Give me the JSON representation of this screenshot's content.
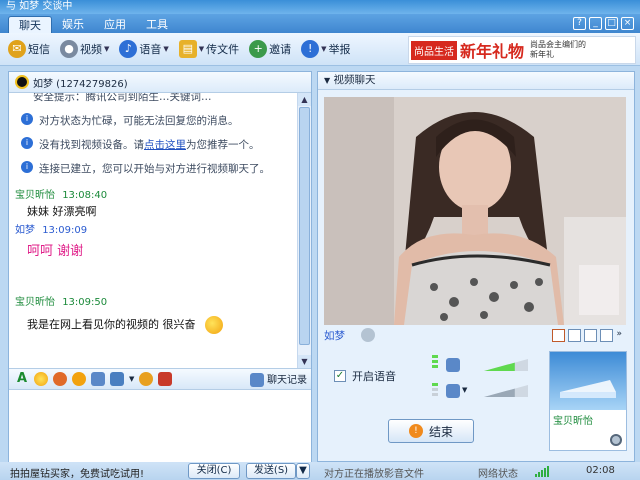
{
  "window": {
    "title": "与 如梦 交谈中"
  },
  "menu": {
    "tabs": [
      "聊天",
      "娱乐",
      "应用",
      "工具"
    ],
    "window_buttons": [
      "?",
      "_",
      "□",
      "×"
    ]
  },
  "toolbar": {
    "items": [
      {
        "label": "短信",
        "icon": "sms-icon",
        "color": "#e0a21b"
      },
      {
        "label": "视频",
        "icon": "camera-icon",
        "color": "#7a8aa0"
      },
      {
        "label": "语音",
        "icon": "microphone-icon",
        "color": "#2d6fd6"
      },
      {
        "label": "传文件",
        "icon": "folder-icon",
        "color": "#e7b12a"
      },
      {
        "label": "邀请",
        "icon": "invite-icon",
        "color": "#3b9a4b"
      },
      {
        "label": "举报",
        "icon": "report-icon",
        "color": "#2d6fd6"
      }
    ]
  },
  "ad": {
    "tag": "尚品生活",
    "headline": "新年礼物",
    "small": "尚品会主编们的新年礼"
  },
  "contact": {
    "name_and_qq": "如梦 (1274279826)"
  },
  "chat": {
    "truncated_line": "安全提示：腾讯公司到陌生…关键词…",
    "system_messages": [
      {
        "text": "对方状态为忙碌，可能无法回复您的消息。"
      },
      {
        "text_before": "没有找到视频设备。请",
        "link": "点击这里",
        "text_after": "为您推荐一个。"
      },
      {
        "text": "连接已建立，您可以开始与对方进行视频聊天了。"
      }
    ],
    "messages": [
      {
        "sender": "宝贝昕怡",
        "time": "13:08:40",
        "text": "妹妹  好漂亮啊",
        "sender_color": "green"
      },
      {
        "sender": "如梦",
        "time": "13:09:09",
        "text": "呵呵  谢谢",
        "sender_color": "blue",
        "style": "pink"
      },
      {
        "sender": "宝贝昕怡",
        "time": "13:09:50",
        "text": "我是在网上看见你的视频的  很兴奋",
        "sender_color": "green",
        "emoji": "smile-emoji"
      }
    ]
  },
  "format_bar": {
    "history_label": "聊天记录"
  },
  "bottom": {
    "tip": "拍拍屋钻买家，免费试吃试用!",
    "close_label": "关闭(C)",
    "send_label": "发送(S)",
    "status": "对方正在播放影音文件",
    "network_label": "网络状态",
    "signal_level": 5,
    "time": "02:08"
  },
  "video_panel": {
    "title": "视频聊天",
    "remote_name": "如梦",
    "audio_label": "开启语音",
    "audio_enabled": true,
    "end_label": "结束",
    "mic_level_fraction": 0.7,
    "speaker_level_fraction": 0.7
  },
  "self_preview": {
    "name": "宝贝昕怡"
  }
}
